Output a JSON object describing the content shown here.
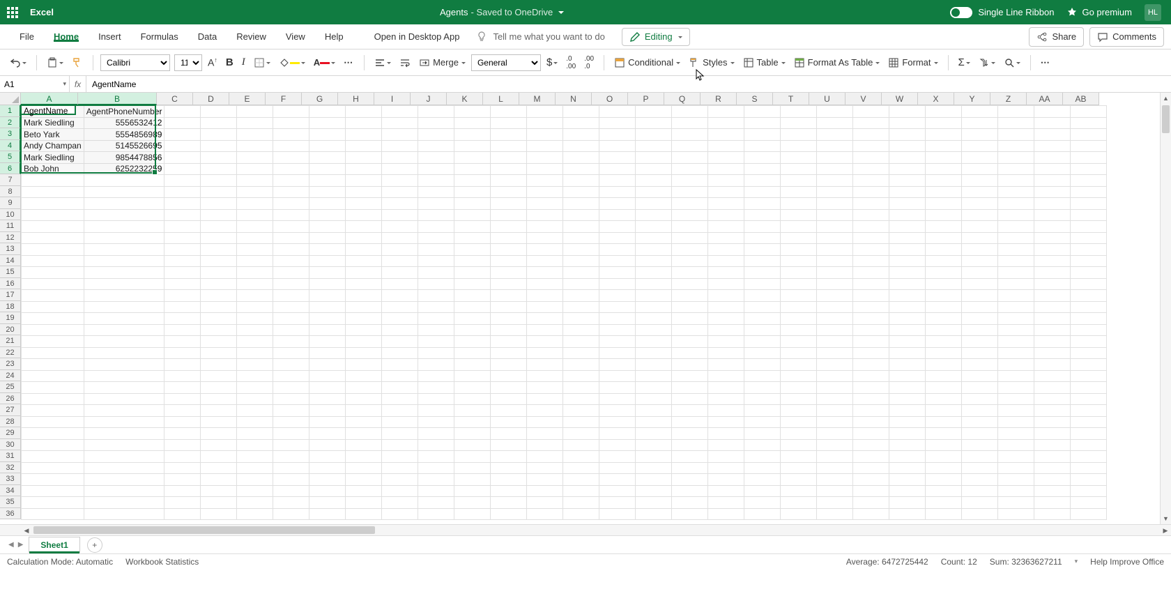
{
  "title": {
    "app": "Excel",
    "doc": "Agents",
    "saved": " - Saved to OneDrive",
    "ribbon_mode": "Single Line Ribbon",
    "premium": "Go premium",
    "account": "HL"
  },
  "tabs": {
    "file": "File",
    "home": "Home",
    "insert": "Insert",
    "formulas": "Formulas",
    "data": "Data",
    "review": "Review",
    "view": "View",
    "help": "Help",
    "open_desktop": "Open in Desktop App",
    "tell_me": "Tell me what you want to do",
    "editing": "Editing",
    "share": "Share",
    "comments": "Comments"
  },
  "ribbon": {
    "font_name": "Calibri",
    "font_size": "11",
    "merge": "Merge",
    "num_format": "General",
    "conditional": "Conditional",
    "styles": "Styles",
    "table": "Table",
    "format_as_table": "Format As Table",
    "format": "Format"
  },
  "fx": {
    "name_box": "A1",
    "formula": "AgentName",
    "fx_label": "fx"
  },
  "columns": [
    "A",
    "B",
    "C",
    "D",
    "E",
    "F",
    "G",
    "H",
    "I",
    "J",
    "K",
    "L",
    "M",
    "N",
    "O",
    "P",
    "Q",
    "R",
    "S",
    "T",
    "U",
    "V",
    "W",
    "X",
    "Y",
    "Z",
    "AA",
    "AB"
  ],
  "col_widths_sel": {
    "A": 82,
    "B": 113
  },
  "col_width_default": 52,
  "row_count": 36,
  "sel_rows": 6,
  "cells": {
    "A1": "AgentName",
    "B1": "AgentPhoneNumber",
    "A2": "Mark Siedling",
    "B2": "5556532412",
    "A3": "Beto Yark",
    "B3": "5554856989",
    "A4": "Andy Champan",
    "B4": "5145526695",
    "A5": "Mark Siedling",
    "B5": "9854478856",
    "A6": "Bob John",
    "B6": "6252232259"
  },
  "sheet": {
    "name": "Sheet1"
  },
  "status": {
    "calc_mode": "Calculation Mode: Automatic",
    "wb_stats": "Workbook Statistics",
    "average": "Average: 6472725442",
    "count": "Count: 12",
    "sum": "Sum: 32363627211",
    "help": "Help Improve Office"
  }
}
